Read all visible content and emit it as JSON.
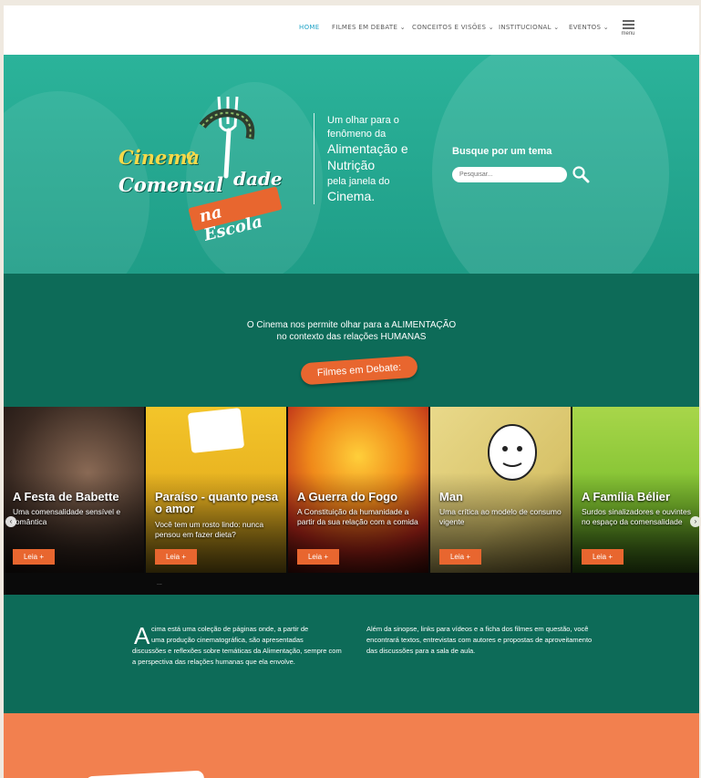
{
  "nav": {
    "items": [
      {
        "label": "HOME",
        "active": true
      },
      {
        "label": "FILMES EM DEBATE ⌄",
        "active": false
      },
      {
        "label": "CONCEITOS E VISÕES ⌄",
        "active": false
      },
      {
        "label": "INSTITUCIONAL ⌄",
        "active": false
      },
      {
        "label": "EVENTOS ⌄",
        "active": false
      }
    ],
    "menu_label": "menu"
  },
  "hero": {
    "logo": {
      "line1": "Cinema",
      "line1b": "e",
      "line2": "Comensal",
      "line2b": "dade",
      "line3": "na Escola"
    },
    "tagline": {
      "l1": "Um olhar para o",
      "l2": "fenômeno da",
      "l3": "Alimentação e",
      "l4": "Nutrição",
      "l5": "pela janela do",
      "l6": "Cinema."
    },
    "search": {
      "label": "Busque por um tema",
      "placeholder": "Pesquisar..."
    }
  },
  "intro": {
    "line1": "O Cinema nos permite olhar para a ALIMENTAÇÃO",
    "line2": "no contexto das relações HUMANAS",
    "button": "Filmes em Debate:"
  },
  "carousel": {
    "cards": [
      {
        "title": "A Festa de Babette",
        "desc": "Uma comensalidade sensível e romântica",
        "button": "Leia  +"
      },
      {
        "title": "Paraíso - quanto pesa o amor",
        "desc": "Você tem um rosto lindo: nunca pensou em fazer dieta?",
        "button": "Leia  +"
      },
      {
        "title": "A Guerra do Fogo",
        "desc": "A Constituição da humanidade a partir da sua relação com a comida",
        "button": "Leia  +"
      },
      {
        "title": "Man",
        "desc": "Uma crítica ao modelo de consumo vigente",
        "button": "Leia  +"
      },
      {
        "title": "A Família Bélier",
        "desc": "Surdos sinalizadores e ouvintes no espaço da comensalidade",
        "button": "Leia  +"
      }
    ],
    "prev": "‹",
    "next": "›",
    "dots": "..."
  },
  "about": {
    "dropcap": "A",
    "col1_l1": "cima está uma coleção de páginas onde, a partir de",
    "col1_l2": "uma produção cinematográfica, são apresentadas",
    "col1_rest": "discussões e reflexões sobre temáticas da Alimentação, sempre com a perspectiva das relações humanas que ela envolve.",
    "col2": "Além da sinopse, links para vídeos e a ficha dos filmes em questão, você encontrará  textos, entrevistas com autores e propostas de aproveitamento das discussões para a sala de aula."
  },
  "colors": {
    "teal_dark": "#0d6b58",
    "teal_hero": "#2bb39a",
    "orange": "#e8662f",
    "nav_active": "#1fa3c7"
  }
}
